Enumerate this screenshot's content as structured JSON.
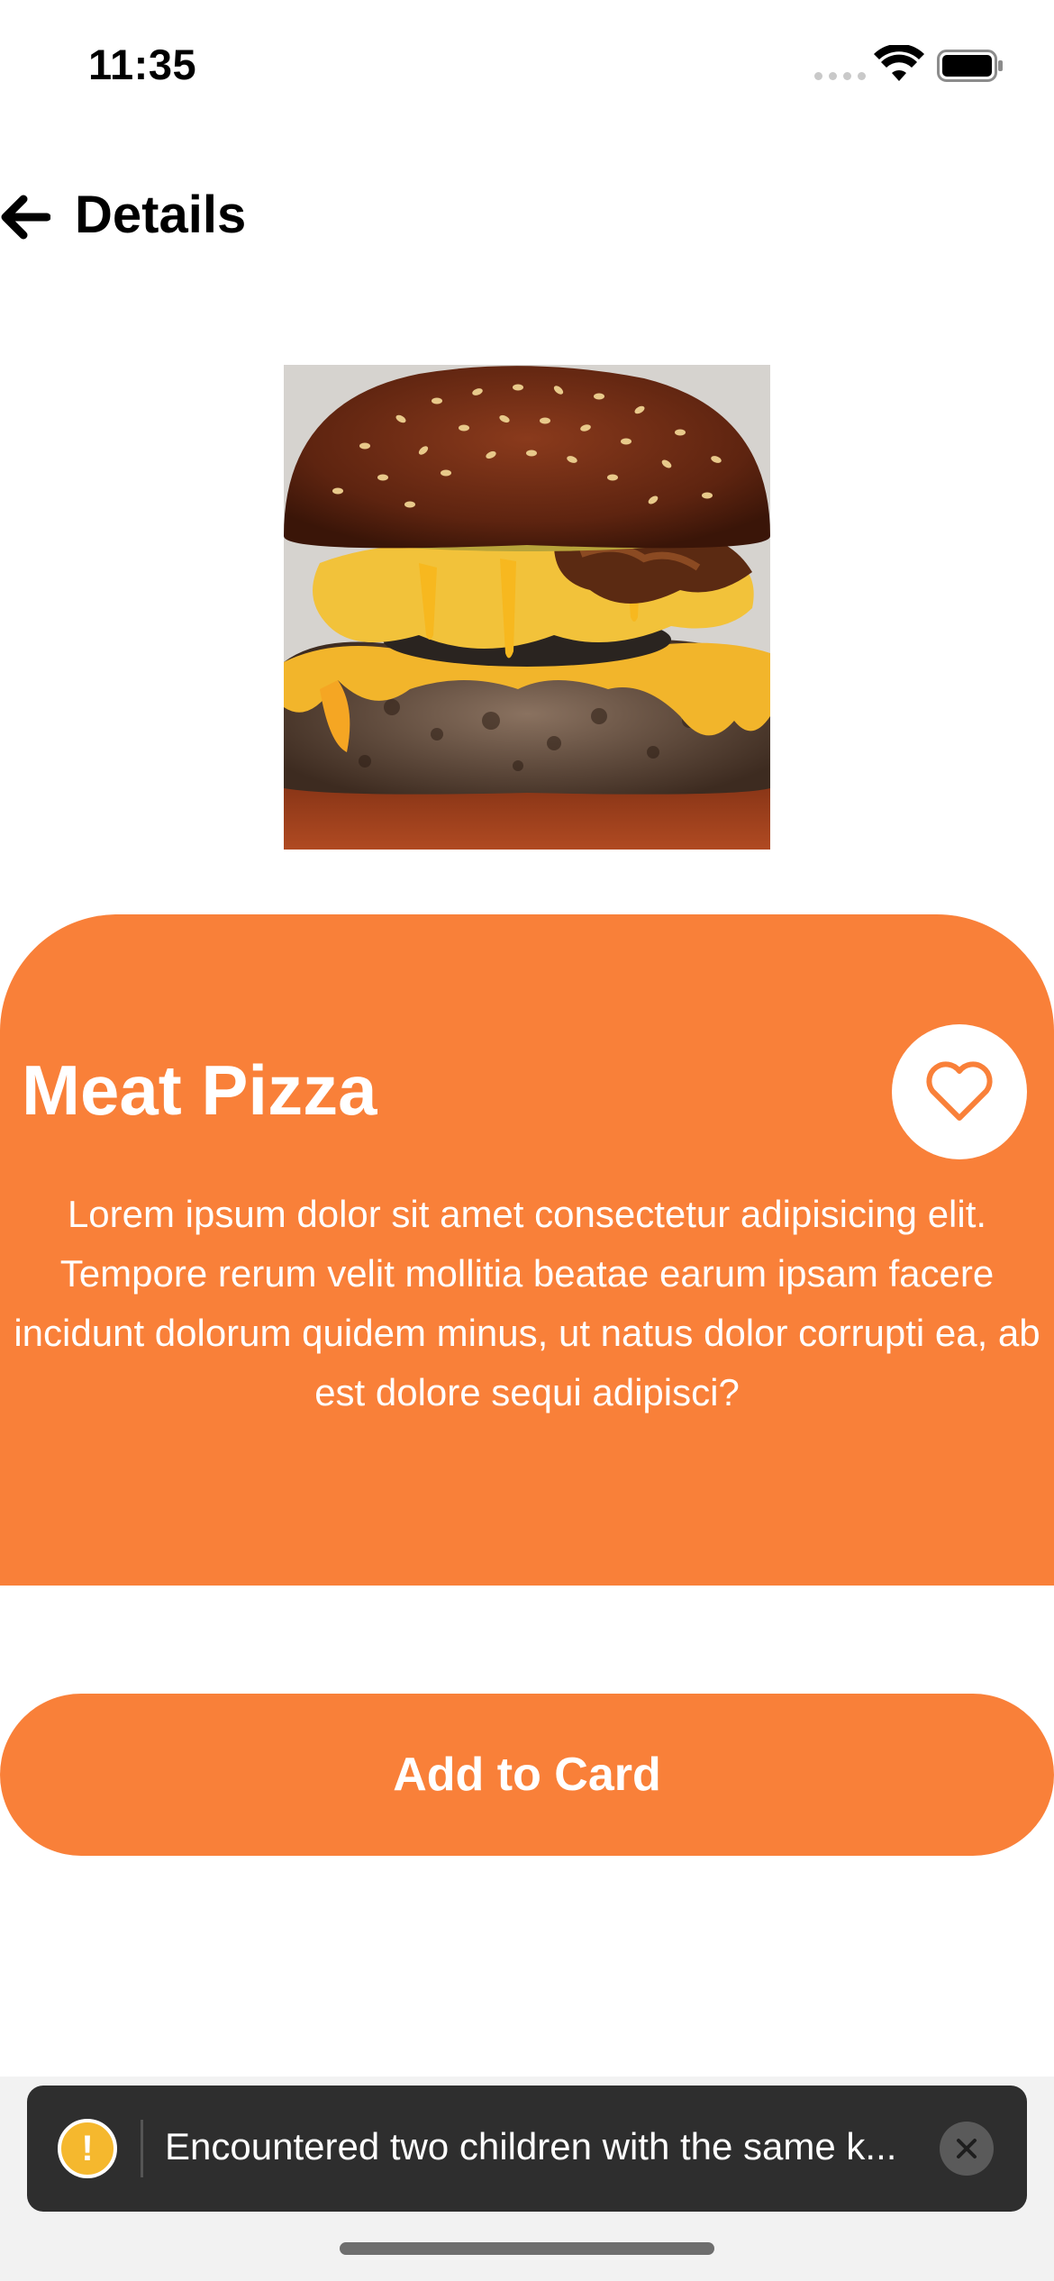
{
  "status_bar": {
    "time": "11:35",
    "icons": [
      "signal-icon",
      "wifi-icon",
      "battery-icon"
    ]
  },
  "header": {
    "back_icon": "arrow-left-icon",
    "title": "Details"
  },
  "product": {
    "image_alt": "burger-image",
    "name": "Meat Pizza",
    "favorite_icon": "heart-icon",
    "description": "Lorem ipsum dolor sit amet consectetur adipisicing elit. Tempore rerum velit mollitia beatae earum ipsam facere incidunt dolorum quidem minus, ut natus dolor corrupti ea, ab est dolore sequi adipisci?"
  },
  "actions": {
    "add_label": "Add to Card"
  },
  "toast": {
    "icon": "warning-icon",
    "icon_glyph": "!",
    "message": "Encountered two children with the same k...",
    "close_icon": "close-icon"
  },
  "colors": {
    "accent": "#f98039",
    "toast_bg": "#2e2e2e",
    "warning": "#f5b82e"
  }
}
